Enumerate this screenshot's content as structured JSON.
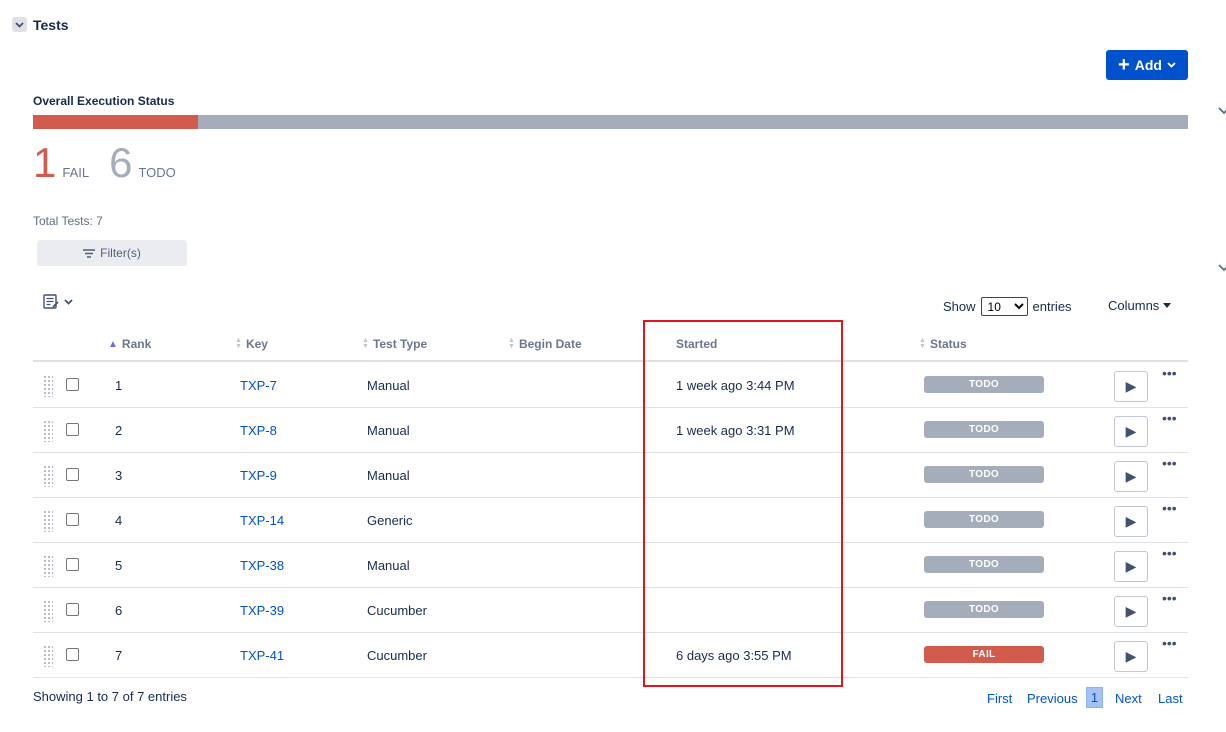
{
  "section": {
    "title": "Tests"
  },
  "add_button": {
    "label": "Add"
  },
  "overall": {
    "label": "Overall Execution Status",
    "fail_fraction": 0.1428,
    "todo_fraction": 0.8572,
    "fail_count": "1",
    "fail_label": "FAIL",
    "todo_count": "6",
    "todo_label": "TODO",
    "colors": {
      "fail": "#d15b4c",
      "todo": "#a5adba"
    }
  },
  "total_tests": "Total Tests: 7",
  "filter_button": {
    "label": "Filter(s)"
  },
  "length_menu": {
    "prefix": "Show",
    "selected": "10",
    "suffix": "entries"
  },
  "columns_button": {
    "label": "Columns"
  },
  "table": {
    "headers": {
      "rank": "Rank",
      "key": "Key",
      "test_type": "Test Type",
      "begin_date": "Begin Date",
      "started": "Started",
      "status": "Status"
    },
    "rows": [
      {
        "rank": "1",
        "key": "TXP-7",
        "type": "Manual",
        "started": "1 week ago 3:44 PM",
        "status": "TODO"
      },
      {
        "rank": "2",
        "key": "TXP-8",
        "type": "Manual",
        "started": "1 week ago 3:31 PM",
        "status": "TODO"
      },
      {
        "rank": "3",
        "key": "TXP-9",
        "type": "Manual",
        "started": "",
        "status": "TODO"
      },
      {
        "rank": "4",
        "key": "TXP-14",
        "type": "Generic",
        "started": "",
        "status": "TODO"
      },
      {
        "rank": "5",
        "key": "TXP-38",
        "type": "Manual",
        "started": "",
        "status": "TODO"
      },
      {
        "rank": "6",
        "key": "TXP-39",
        "type": "Cucumber",
        "started": "",
        "status": "TODO"
      },
      {
        "rank": "7",
        "key": "TXP-41",
        "type": "Cucumber",
        "started": "6 days ago 3:55 PM",
        "status": "FAIL"
      }
    ]
  },
  "info": "Showing 1 to 7 of 7 entries",
  "pagination": {
    "first": "First",
    "previous": "Previous",
    "current": "1",
    "next": "Next",
    "last": "Last"
  },
  "status_colors": {
    "TODO": "#a5adba",
    "FAIL": "#d15b4c"
  }
}
